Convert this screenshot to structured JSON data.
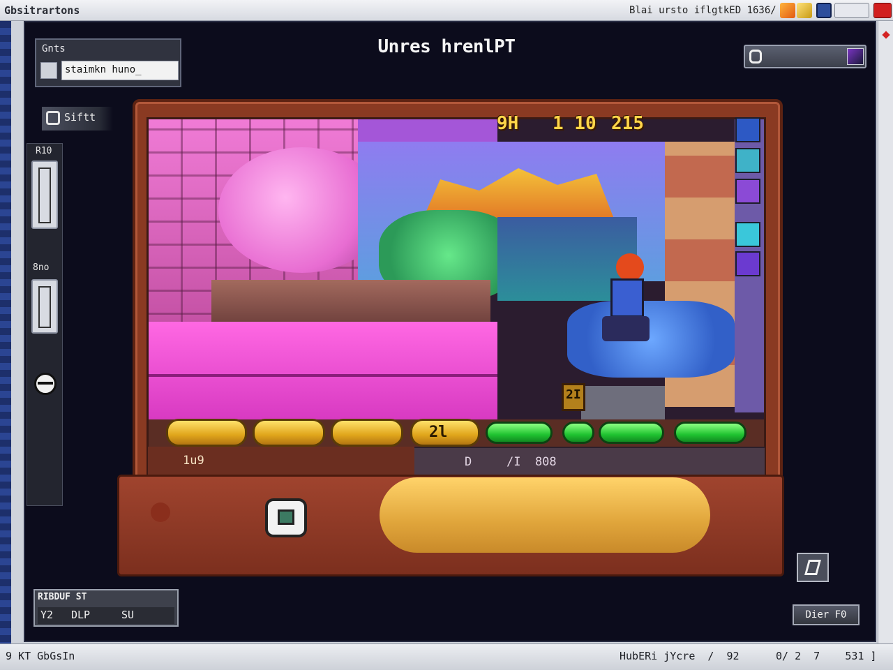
{
  "window": {
    "app_title": "Gbsitrartons",
    "doc_title": "Blai ursto iflgtkED 1636/"
  },
  "header": {
    "title": "Unres hrenlPT",
    "panel_label": "Gnts",
    "panel_field": "staimkn huno_"
  },
  "sidebar": {
    "tab_label": "Siftt",
    "slot1_label": "R10",
    "slot2_label": "8no"
  },
  "hud": {
    "score_left": "9H",
    "score_mid": "1 10",
    "score_right": "215"
  },
  "game": {
    "pill_label": "2l",
    "bar_left_label": "1u9",
    "bar_mid_label": "D",
    "bar_right_label": "/I  808",
    "small_label": "2I"
  },
  "bottom_left": {
    "title": "RIBDUF ST",
    "values": [
      "Y2",
      "DLP",
      "SU"
    ]
  },
  "bottom_right_button": "Dier F0",
  "statusbar": {
    "left": "9 KT GbGsIn",
    "mid": "HubERi jYcre  /  92",
    "right": "0/ 2  7    531 ]"
  },
  "colors": {
    "frame": "#8a3a22",
    "hud_text": "#ffd64a",
    "pill_gold": "#e0a51b",
    "pill_green": "#20c431",
    "background": "#0c0c1c"
  }
}
